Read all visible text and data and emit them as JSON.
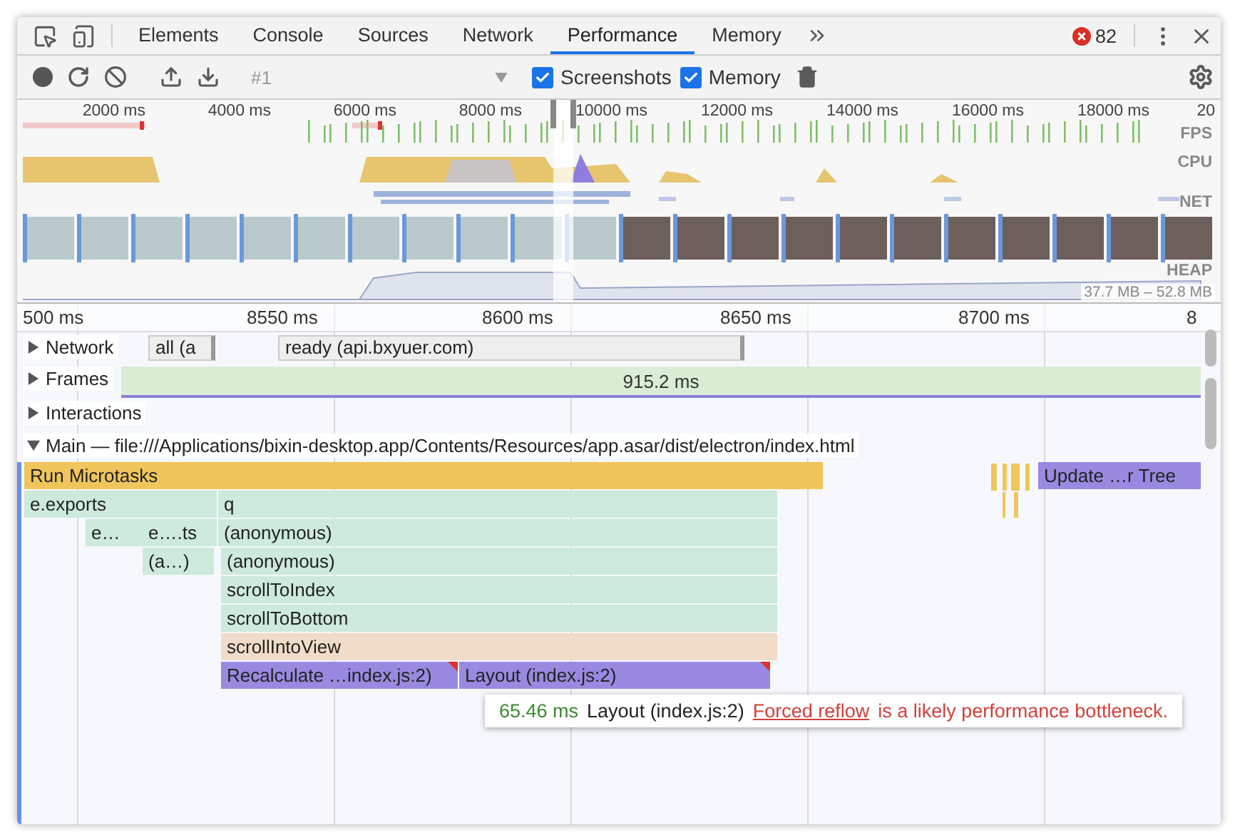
{
  "tabs": [
    {
      "label": "Elements",
      "selected": false
    },
    {
      "label": "Console",
      "selected": false
    },
    {
      "label": "Sources",
      "selected": false
    },
    {
      "label": "Network",
      "selected": false
    },
    {
      "label": "Performance",
      "selected": true
    },
    {
      "label": "Memory",
      "selected": false
    }
  ],
  "error_count": "82",
  "toolbar": {
    "recording": "#1",
    "checkboxes": [
      {
        "label": "Screenshots",
        "checked": true
      },
      {
        "label": "Memory",
        "checked": true
      }
    ]
  },
  "overview": {
    "time_labels": [
      "2000 ms",
      "4000 ms",
      "6000 ms",
      "8000 ms",
      "10000 ms",
      "12000 ms",
      "14000 ms",
      "16000 ms",
      "18000 ms",
      "20"
    ],
    "lanes": [
      "FPS",
      "CPU",
      "NET",
      "HEAP"
    ],
    "heap_range": "37.7 MB – 52.8 MB"
  },
  "timeline": {
    "time_labels": [
      "500 ms",
      "8550 ms",
      "8600 ms",
      "8650 ms",
      "8700 ms",
      "8"
    ]
  },
  "tracks": [
    {
      "name": "Network",
      "expanded": false,
      "items": [
        "all (a",
        "ready (api.bxyuer.com)"
      ]
    },
    {
      "name": "Frames",
      "expanded": false,
      "items": [
        "915.2 ms"
      ]
    },
    {
      "name": "Interactions",
      "expanded": false
    },
    {
      "name": "Main — file:///Applications/bixin-desktop.app/Contents/Resources/app.asar/dist/electron/index.html",
      "expanded": true
    }
  ],
  "flame": [
    [
      {
        "label": "Run Microtasks",
        "kind": "task",
        "warning": false
      },
      {
        "label": "Update …r Tree",
        "kind": "rendering",
        "warning": false
      }
    ],
    [
      {
        "label": "e.exports",
        "kind": "script",
        "warning": false
      },
      {
        "label": "q",
        "kind": "script",
        "warning": false
      }
    ],
    [
      {
        "label": "e…",
        "kind": "script",
        "warning": false
      },
      {
        "label": "e….ts",
        "kind": "script",
        "warning": false
      },
      {
        "label": "(anonymous)",
        "kind": "script",
        "warning": false
      }
    ],
    [
      {
        "label": "(a…)",
        "kind": "script",
        "warning": false
      },
      {
        "label": "(anonymous)",
        "kind": "script",
        "warning": false
      }
    ],
    [
      {
        "label": "scrollToIndex",
        "kind": "script",
        "warning": false
      }
    ],
    [
      {
        "label": "scrollToBottom",
        "kind": "script",
        "warning": false
      }
    ],
    [
      {
        "label": "scrollIntoView",
        "kind": "other",
        "warning": false
      }
    ],
    [
      {
        "label": "Recalculate …index.js:2)",
        "kind": "rendering",
        "warning": true
      },
      {
        "label": "Layout (index.js:2)",
        "kind": "rendering",
        "warning": true
      }
    ]
  ],
  "tooltip": {
    "duration": "65.46 ms",
    "label": "Layout (index.js:2)",
    "link": "Forced reflow",
    "message": "is a likely performance bottleneck."
  }
}
